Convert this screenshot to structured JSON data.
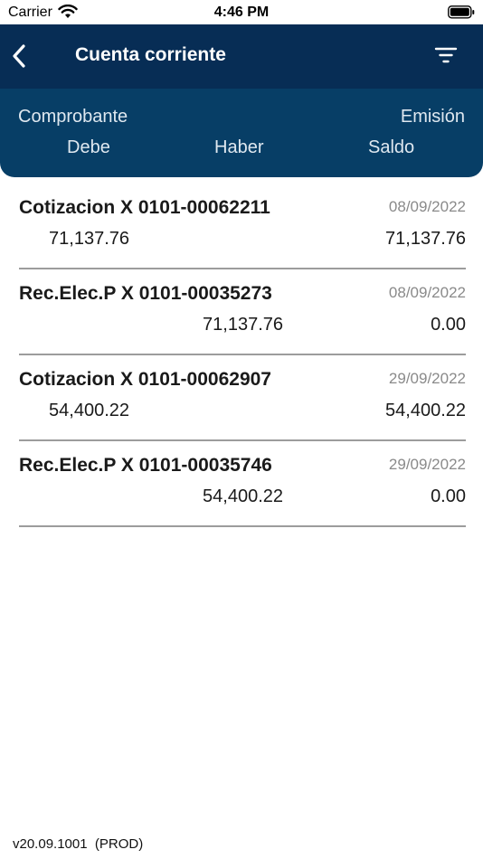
{
  "status_bar": {
    "carrier": "Carrier",
    "time": "4:46 PM"
  },
  "navbar": {
    "title": "Cuenta corriente",
    "background": "#072d55"
  },
  "columns": {
    "comprobante": "Comprobante",
    "emision": "Emisión",
    "debe": "Debe",
    "haber": "Haber",
    "saldo": "Saldo"
  },
  "rows": [
    {
      "comprobante": "Cotizacion X 0101-00062211",
      "fecha": "08/09/2022",
      "debe": "71,137.76",
      "haber": "",
      "saldo": "71,137.76"
    },
    {
      "comprobante": "Rec.Elec.P X 0101-00035273",
      "fecha": "08/09/2022",
      "debe": "",
      "haber": "71,137.76",
      "saldo": "0.00"
    },
    {
      "comprobante": "Cotizacion X 0101-00062907",
      "fecha": "29/09/2022",
      "debe": "54,400.22",
      "haber": "",
      "saldo": "54,400.22"
    },
    {
      "comprobante": "Rec.Elec.P X 0101-00035746",
      "fecha": "29/09/2022",
      "debe": "",
      "haber": "54,400.22",
      "saldo": "0.00"
    }
  ],
  "footer": {
    "version": "v20.09.1001  (PROD)"
  },
  "icons": {
    "back": "chevron-left-icon",
    "filter": "filter-icon",
    "wifi": "wifi-icon",
    "battery": "battery-icon"
  }
}
